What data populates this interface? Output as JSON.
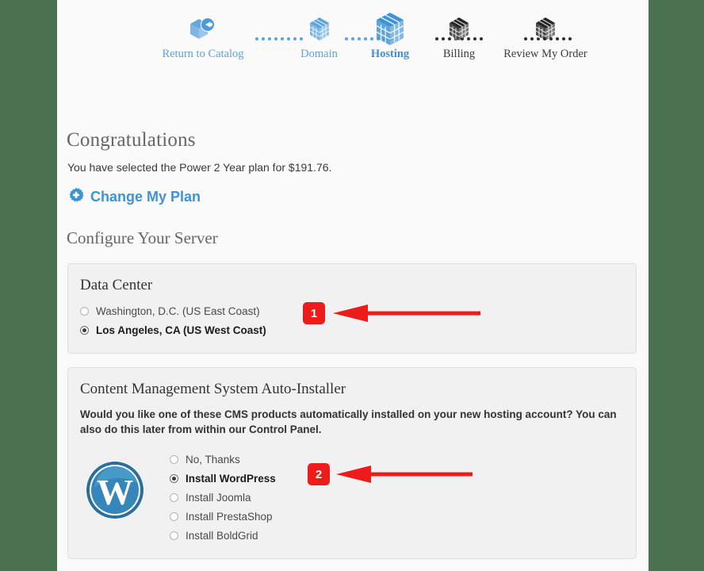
{
  "theme": {
    "background": "#4a7150",
    "page_bg": "#fafafa",
    "accent_blue": "#3d93d4",
    "panel_bg": "#f1f1f1",
    "annotation_red": "#ee1b1b"
  },
  "stepper": {
    "steps": [
      {
        "label": "Return to Catalog",
        "icon": "cube-back-arrow-icon",
        "state": "done"
      },
      {
        "label": "Domain",
        "icon": "cube-icon",
        "state": "done"
      },
      {
        "label": "Hosting",
        "icon": "cube-icon",
        "state": "active"
      },
      {
        "label": "Billing",
        "icon": "cube-icon",
        "state": "todo"
      },
      {
        "label": "Review My Order",
        "icon": "cube-icon",
        "state": "todo"
      }
    ]
  },
  "content": {
    "heading": "Congratulations",
    "selection_text": "You have selected the Power 2 Year plan for $191.76.",
    "change_plan_label": "Change My Plan",
    "change_plan_icon": "gear-plus-icon",
    "configure_heading": "Configure Your Server"
  },
  "data_center": {
    "title": "Data Center",
    "options": [
      {
        "label": "Washington, D.C. (US East Coast)",
        "selected": false
      },
      {
        "label": "Los Angeles, CA (US West Coast)",
        "selected": true
      }
    ]
  },
  "cms": {
    "title": "Content Management System Auto-Installer",
    "description": "Would you like one of these CMS products automatically installed on your new hosting account? You can also do this later from within our Control Panel.",
    "logo_icon": "wordpress-logo-icon",
    "options": [
      {
        "label": "No, Thanks",
        "selected": false
      },
      {
        "label": "Install WordPress",
        "selected": true
      },
      {
        "label": "Install Joomla",
        "selected": false
      },
      {
        "label": "Install PrestaShop",
        "selected": false
      },
      {
        "label": "Install BoldGrid",
        "selected": false
      }
    ]
  },
  "annotations": [
    {
      "number": "1",
      "target": "data-center-options"
    },
    {
      "number": "2",
      "target": "cms-options"
    }
  ]
}
